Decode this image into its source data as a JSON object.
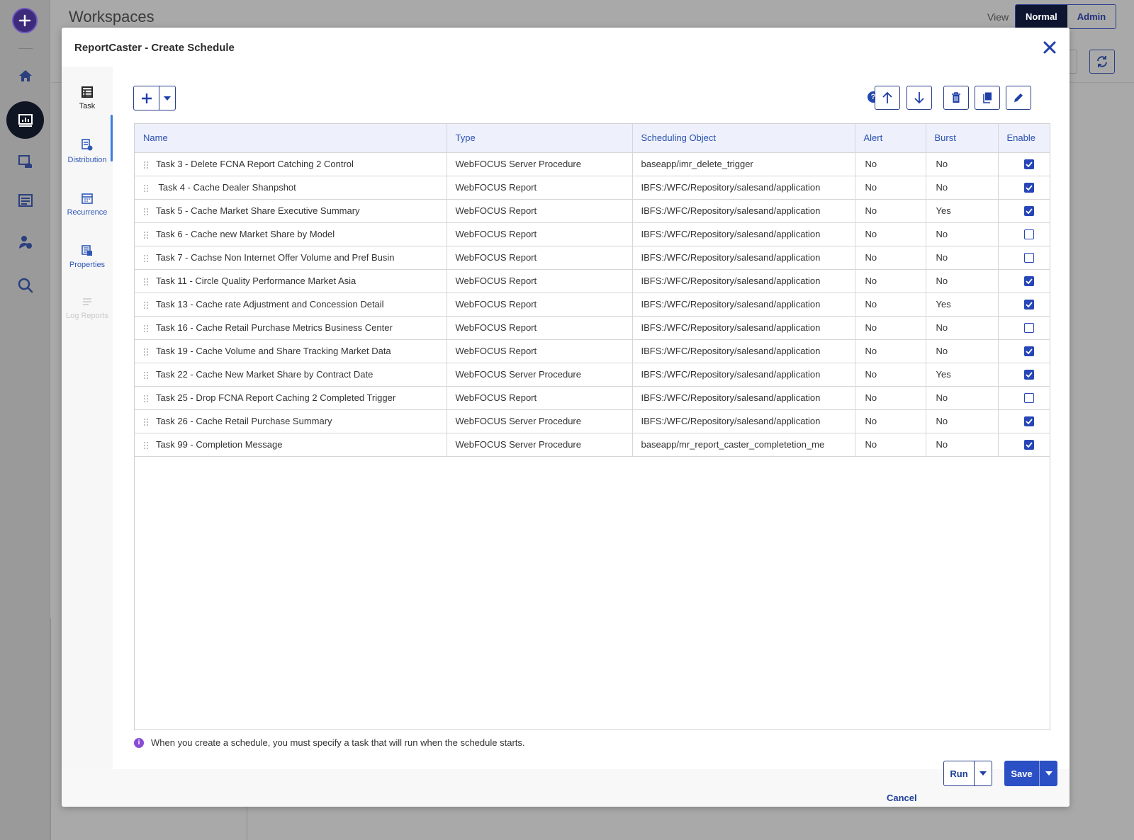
{
  "background": {
    "title": "Workspaces",
    "view_label": "View",
    "view_options": [
      "Normal",
      "Admin"
    ],
    "view_selected": "Normal"
  },
  "rail": {
    "icons": [
      "plus-icon",
      "home-icon",
      "reports-icon",
      "content-icon",
      "explorer-icon",
      "user-settings-icon",
      "search-icon"
    ]
  },
  "modal": {
    "title": "ReportCaster - Create Schedule",
    "nav": [
      {
        "label": "Task",
        "icon": "task-icon",
        "state": "active"
      },
      {
        "label": "Distribution",
        "icon": "distribution-icon",
        "state": "normal"
      },
      {
        "label": "Recurrence",
        "icon": "calendar-icon",
        "state": "normal"
      },
      {
        "label": "Properties",
        "icon": "properties-icon",
        "state": "normal"
      },
      {
        "label": "Log Reports",
        "icon": "log-icon",
        "state": "disabled"
      }
    ],
    "table": {
      "columns": [
        "Name",
        "Type",
        "Scheduling Object",
        "Alert",
        "Burst",
        "Enable"
      ],
      "rows": [
        {
          "name": "Task 3 - Delete FCNA Report Catching 2 Control",
          "type": "WebFOCUS Server Procedure",
          "object": "baseapp/imr_delete_trigger",
          "alert": "No",
          "burst": "No",
          "enabled": true
        },
        {
          "name": " Task 4 - Cache Dealer Shanpshot",
          "type": "WebFOCUS Report",
          "object": "IBFS:/WFC/Repository/salesand/application",
          "alert": "No",
          "burst": "No",
          "enabled": true
        },
        {
          "name": "Task 5 - Cache Market Share Executive Summary",
          "type": "WebFOCUS Report",
          "object": "IBFS:/WFC/Repository/salesand/application",
          "alert": "No",
          "burst": "Yes",
          "enabled": true
        },
        {
          "name": "Task 6 - Cache new Market Share by Model",
          "type": "WebFOCUS Report",
          "object": "IBFS:/WFC/Repository/salesand/application",
          "alert": "No",
          "burst": "No",
          "enabled": false
        },
        {
          "name": "Task 7 - Cachse Non Internet Offer Volume and Pref Busin",
          "type": "WebFOCUS Report",
          "object": "IBFS:/WFC/Repository/salesand/application",
          "alert": "No",
          "burst": "No",
          "enabled": false
        },
        {
          "name": "Task 11 - Circle Quality Performance Market Asia",
          "type": "WebFOCUS Report",
          "object": "IBFS:/WFC/Repository/salesand/application",
          "alert": "No",
          "burst": "No",
          "enabled": true
        },
        {
          "name": "Task 13 - Cache rate Adjustment and Concession Detail",
          "type": "WebFOCUS Report",
          "object": "IBFS:/WFC/Repository/salesand/application",
          "alert": "No",
          "burst": "Yes",
          "enabled": true
        },
        {
          "name": "Task 16 - Cache Retail Purchase Metrics Business Center",
          "type": "WebFOCUS Report",
          "object": "IBFS:/WFC/Repository/salesand/application",
          "alert": "No",
          "burst": "No",
          "enabled": false
        },
        {
          "name": "Task 19 - Cache Volume and Share Tracking Market Data",
          "type": "WebFOCUS Report",
          "object": "IBFS:/WFC/Repository/salesand/application",
          "alert": "No",
          "burst": "No",
          "enabled": true
        },
        {
          "name": "Task 22 - Cache New Market Share by Contract Date",
          "type": "WebFOCUS Server Procedure",
          "object": "IBFS:/WFC/Repository/salesand/application",
          "alert": "No",
          "burst": "Yes",
          "enabled": true
        },
        {
          "name": "Task 25 - Drop FCNA Report Caching 2 Completed Trigger",
          "type": "WebFOCUS Report",
          "object": "IBFS:/WFC/Repository/salesand/application",
          "alert": "No",
          "burst": "No",
          "enabled": false
        },
        {
          "name": "Task 26 - Cache Retail Purchase Summary",
          "type": "WebFOCUS Server Procedure",
          "object": "IBFS:/WFC/Repository/salesand/application",
          "alert": "No",
          "burst": "No",
          "enabled": true
        },
        {
          "name": "Task 99 - Completion Message",
          "type": "WebFOCUS Server Procedure",
          "object": "baseapp/mr_report_caster_completetion_me",
          "alert": "No",
          "burst": "No",
          "enabled": true
        }
      ]
    },
    "toolbar": {
      "help": "?",
      "buttons": [
        "add-icon",
        "move-up-icon",
        "move-down-icon",
        "delete-icon",
        "copy-icon",
        "edit-icon"
      ]
    },
    "info_note": "When you create a schedule, you must specify a task that will run when the schedule starts.",
    "footer": {
      "cancel": "Cancel",
      "run": "Run",
      "save": "Save"
    }
  },
  "colors": {
    "accent": "#2645b6",
    "header_bg": "#eef1fb",
    "link": "#2f58b8",
    "info": "#8a4bd6"
  }
}
